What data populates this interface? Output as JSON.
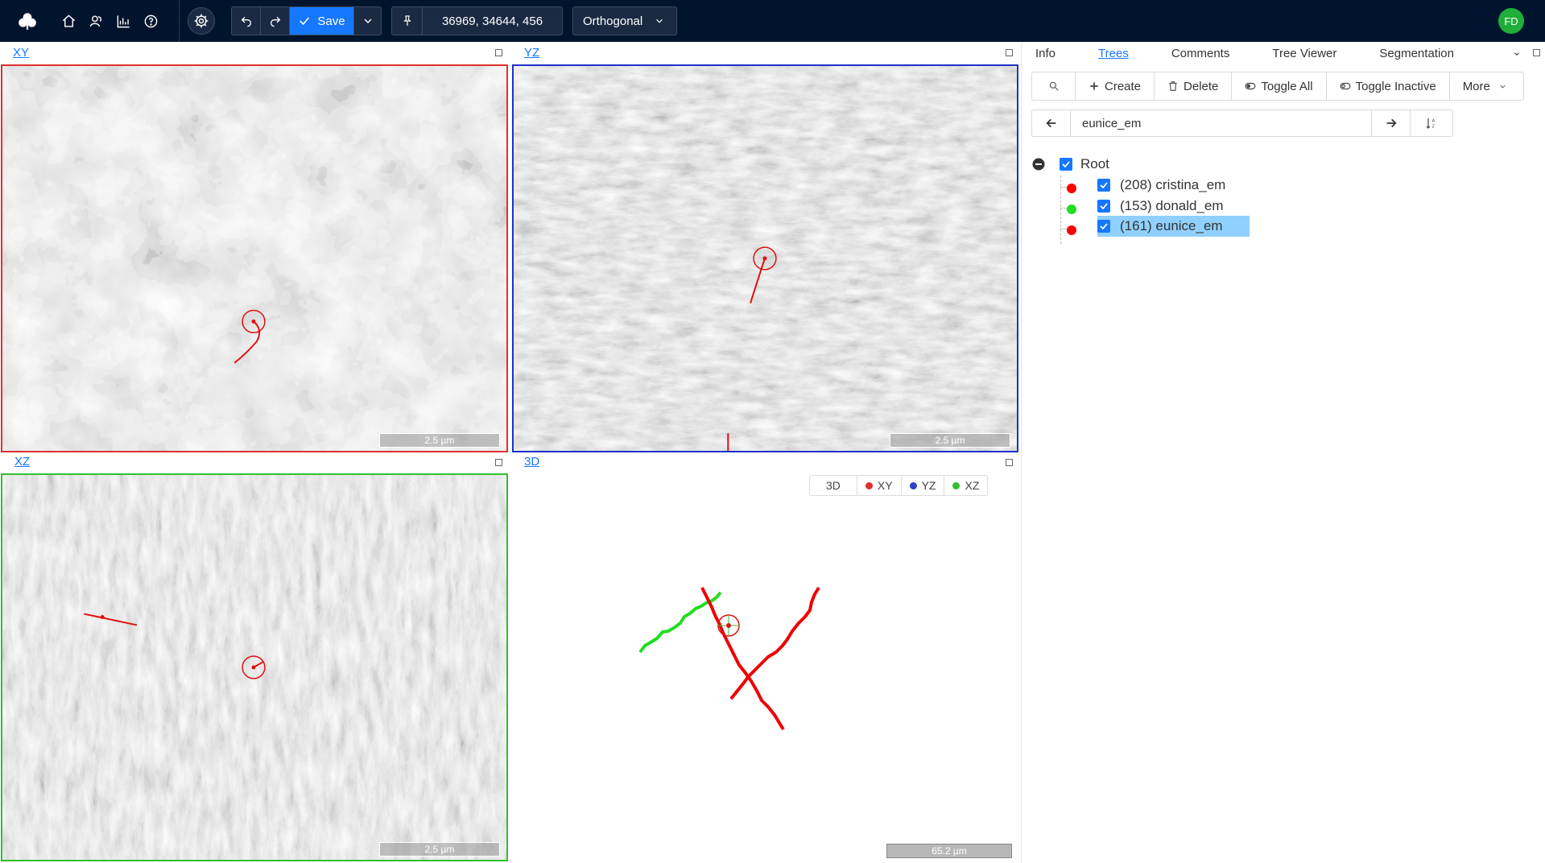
{
  "topbar": {
    "save_label": "Save",
    "position": "36969, 34644, 456",
    "view_mode": "Orthogonal",
    "avatar_initials": "FD"
  },
  "viewports": {
    "xy": {
      "label": "XY",
      "scale": "2.5 µm",
      "border_color": "#e03030"
    },
    "yz": {
      "label": "YZ",
      "scale": "2.5 µm",
      "border_color": "#2030c8"
    },
    "xz": {
      "label": "XZ",
      "scale": "2.5 µm",
      "border_color": "#30c030"
    },
    "td": {
      "label": "3D",
      "scale": "65.2 µm",
      "legend": [
        {
          "label": "3D",
          "color": ""
        },
        {
          "label": "XY",
          "color": "#e03030"
        },
        {
          "label": "YZ",
          "color": "#3040c8"
        },
        {
          "label": "XZ",
          "color": "#30c030"
        }
      ]
    }
  },
  "panel": {
    "tabs": [
      "Info",
      "Trees",
      "Comments",
      "Tree Viewer",
      "Segmentation"
    ],
    "active_tab": "Trees",
    "toolbar": {
      "create": "Create",
      "delete": "Delete",
      "toggle_all": "Toggle All",
      "toggle_inactive": "Toggle Inactive",
      "more": "More"
    },
    "search_value": "eunice_em",
    "tree": {
      "root_label": "Root",
      "items": [
        {
          "label": "(208) cristina_em",
          "color": "#ff0000",
          "selected": false
        },
        {
          "label": "(153) donald_em",
          "color": "#22dd22",
          "selected": false
        },
        {
          "label": "(161) eunice_em",
          "color": "#ff0000",
          "selected": true
        }
      ]
    }
  }
}
